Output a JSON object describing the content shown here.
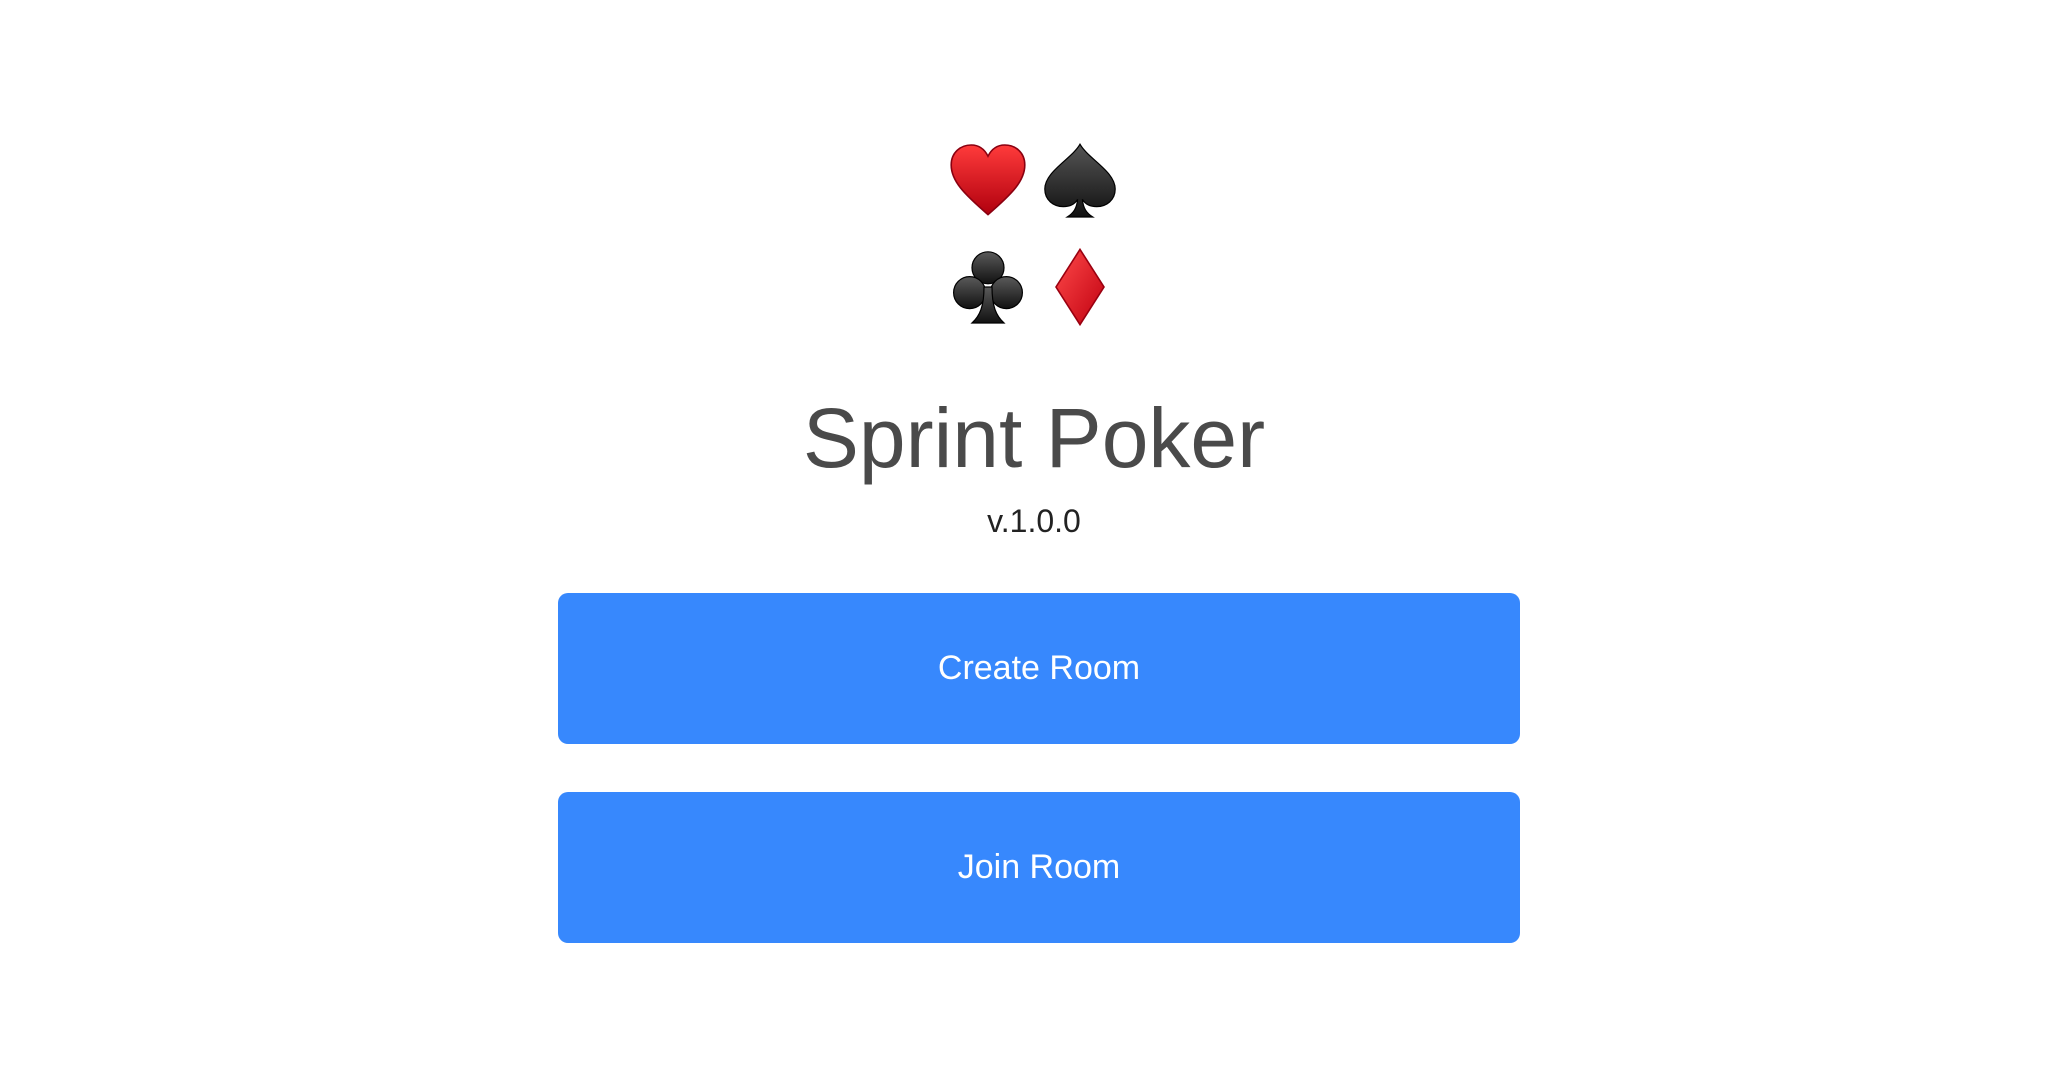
{
  "app": {
    "title": "Sprint Poker",
    "version": "v.1.0.0"
  },
  "logo": {
    "suits": [
      {
        "name": "heart-icon",
        "color": "#d0021b"
      },
      {
        "name": "spade-icon",
        "color": "#1c1c1c"
      },
      {
        "name": "club-icon",
        "color": "#1c1c1c"
      },
      {
        "name": "diamond-icon",
        "color": "#e8161d"
      }
    ]
  },
  "actions": {
    "create_label": "Create Room",
    "join_label": "Join Room",
    "button_color": "#3788fd"
  }
}
